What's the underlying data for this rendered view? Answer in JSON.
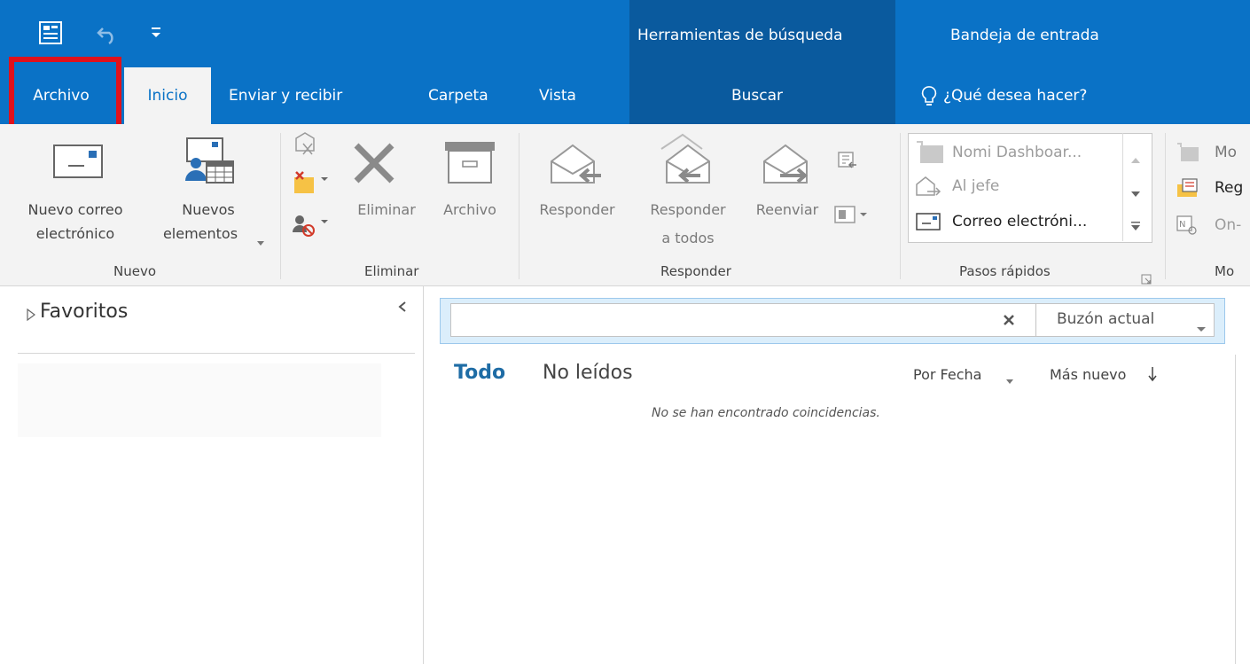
{
  "titlebar": {
    "context_tools_label": "Herramientas de búsqueda",
    "folder_title": "Bandeja de entrada",
    "qat_icons": [
      "send-receive-icon",
      "undo-icon",
      "customize-icon"
    ]
  },
  "tabs": {
    "archivo": "Archivo",
    "inicio": "Inicio",
    "enviar_recibir": "Enviar y recibir",
    "carpeta": "Carpeta",
    "vista": "Vista",
    "buscar": "Buscar",
    "tell_me": "¿Qué desea hacer?"
  },
  "ribbon": {
    "nuevo": {
      "new_email_line1": "Nuevo correo",
      "new_email_line2": "electrónico",
      "new_items_line1": "Nuevos",
      "new_items_line2": "elementos",
      "group": "Nuevo"
    },
    "eliminar": {
      "delete": "Eliminar",
      "archive": "Archivo",
      "group": "Eliminar"
    },
    "responder": {
      "reply": "Responder",
      "reply_all_line1": "Responder",
      "reply_all_line2": "a todos",
      "forward": "Reenviar",
      "group": "Responder"
    },
    "quick_steps": {
      "items": [
        "Nomi Dashboar...",
        "Al jefe",
        "Correo electróni..."
      ],
      "group": "Pasos rápidos"
    },
    "mover": {
      "items": [
        "Mo",
        "Reg",
        "On-"
      ],
      "group": "Mo"
    }
  },
  "left_pane": {
    "favorites": "Favoritos"
  },
  "search": {
    "value": "",
    "scope": "Buzón actual"
  },
  "filters": {
    "all": "Todo",
    "unread": "No leídos",
    "sort_by": "Por Fecha",
    "order": "Más nuevo"
  },
  "messages": {
    "empty": "No se han encontrado coincidencias."
  },
  "colors": {
    "brand_blue": "#0a72c6",
    "context_blue": "#0a5a9e",
    "highlight_red": "#e0111b"
  }
}
